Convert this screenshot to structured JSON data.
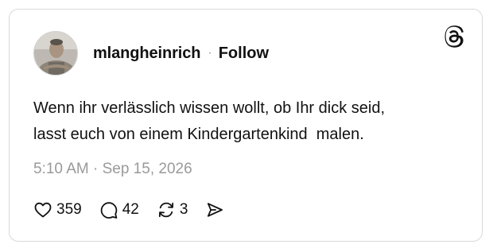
{
  "post": {
    "username": "mlangheinrich",
    "separator": "·",
    "follow_label": "Follow",
    "text": "Wenn ihr verlässlich wissen wollt, ob Ihr dick seid,\nlasst euch von einem Kindergartenkind  malen.",
    "timestamp": "5:10 AM · Sep 15, 2026",
    "likes": "359",
    "replies": "42",
    "reposts": "3"
  },
  "icons": {
    "logo": "threads-logo-icon",
    "like": "heart-icon",
    "reply": "comment-bubble-icon",
    "repost": "repost-icon",
    "share": "send-icon"
  },
  "colors": {
    "text": "#111111",
    "muted": "#9a9a9a",
    "border": "#d9d9d9"
  }
}
